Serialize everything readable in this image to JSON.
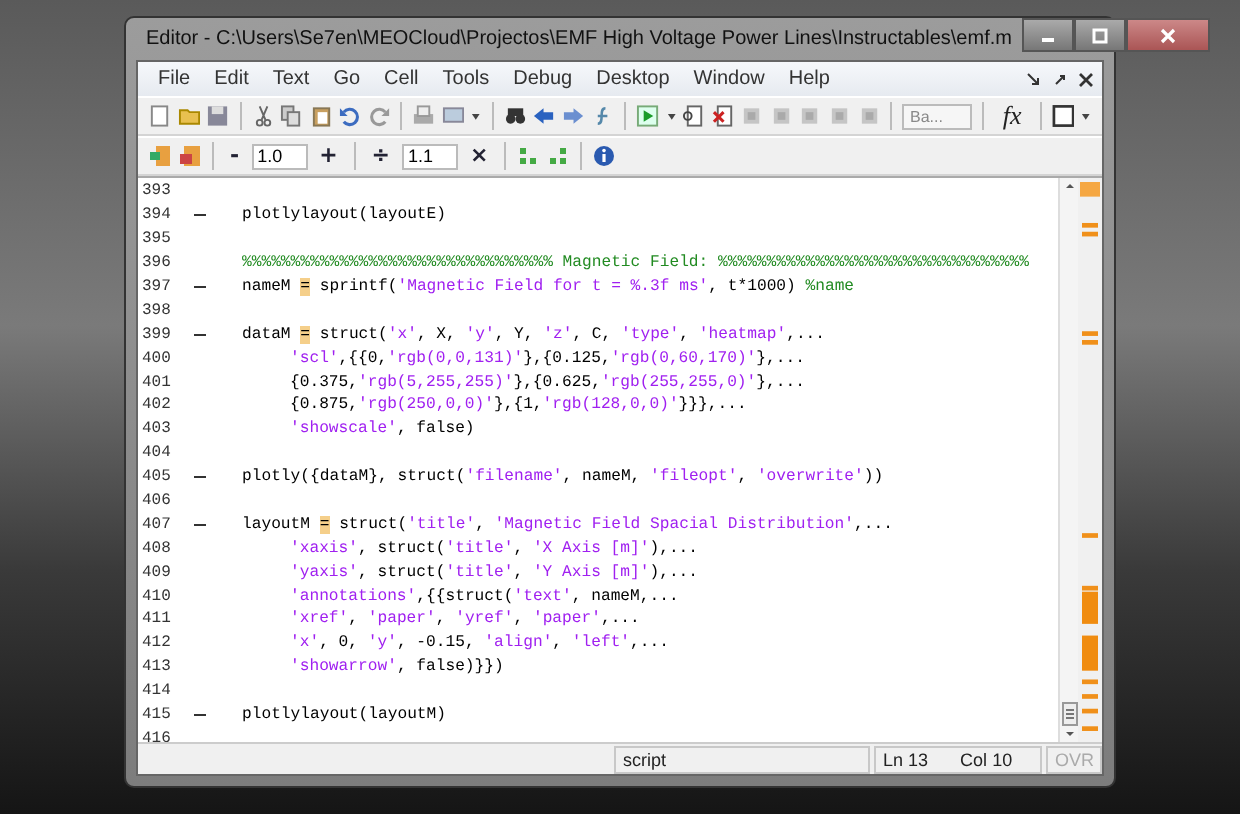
{
  "window": {
    "title": "Editor - C:\\Users\\Se7en\\MEOCloud\\Projectos\\EMF High Voltage Power Lines\\Instructables\\emf.m"
  },
  "menu": [
    "File",
    "Edit",
    "Text",
    "Go",
    "Cell",
    "Tools",
    "Debug",
    "Desktop",
    "Window",
    "Help"
  ],
  "toolbar": {
    "cell_dropdown": "Ba...",
    "fx": "fx"
  },
  "cell_toolbar": {
    "decrement": "-",
    "decrement_value": "1.0",
    "increment": "+",
    "divide": "÷",
    "divide_value": "1.1",
    "multiply": "×"
  },
  "lines": [
    {
      "number": "393",
      "executable": false
    },
    {
      "number": "394",
      "executable": true,
      "segments": [
        {
          "kind": "code",
          "text": "plotlylayout(layoutE)"
        }
      ]
    },
    {
      "number": "395",
      "executable": false
    },
    {
      "number": "396",
      "executable": false,
      "segments": [
        {
          "kind": "comment",
          "text": "%%%%%%%%%%%%%%%%%%%%%%%%%%%%%%%% Magnetic Field: %%%%%%%%%%%%%%%%%%%%%%%%%%%%%%%%"
        }
      ]
    },
    {
      "number": "397",
      "executable": true,
      "segments": [
        {
          "kind": "code",
          "text": "nameM "
        },
        {
          "kind": "marked",
          "text": "="
        },
        {
          "kind": "code",
          "text": " sprintf("
        },
        {
          "kind": "string",
          "text": "'Magnetic Field for t = %.3f ms'"
        },
        {
          "kind": "code",
          "text": ", t*1000) "
        },
        {
          "kind": "comment",
          "text": "%name"
        }
      ]
    },
    {
      "number": "398",
      "executable": false
    },
    {
      "number": "399",
      "executable": true,
      "segments": [
        {
          "kind": "code",
          "text": "dataM "
        },
        {
          "kind": "marked",
          "text": "="
        },
        {
          "kind": "code",
          "text": " struct("
        },
        {
          "kind": "string",
          "text": "'x'"
        },
        {
          "kind": "code",
          "text": ", X, "
        },
        {
          "kind": "string",
          "text": "'y'"
        },
        {
          "kind": "code",
          "text": ", Y, "
        },
        {
          "kind": "string",
          "text": "'z'"
        },
        {
          "kind": "code",
          "text": ", C, "
        },
        {
          "kind": "string",
          "text": "'type'"
        },
        {
          "kind": "code",
          "text": ", "
        },
        {
          "kind": "string",
          "text": "'heatmap'"
        },
        {
          "kind": "code",
          "text": ",..."
        }
      ]
    },
    {
      "number": "400",
      "executable": false,
      "continuation": true,
      "segments": [
        {
          "kind": "string",
          "text": "'scl'"
        },
        {
          "kind": "code",
          "text": ",{{0,"
        },
        {
          "kind": "string",
          "text": "'rgb(0,0,131)'"
        },
        {
          "kind": "code",
          "text": "},{0.125,"
        },
        {
          "kind": "string",
          "text": "'rgb(0,60,170)'"
        },
        {
          "kind": "code",
          "text": "},..."
        }
      ]
    },
    {
      "number": "401",
      "executable": false,
      "continuation": true,
      "segments": [
        {
          "kind": "code",
          "text": "{0.375,"
        },
        {
          "kind": "string",
          "text": "'rgb(5,255,255)'"
        },
        {
          "kind": "code",
          "text": "},{0.625,"
        },
        {
          "kind": "string",
          "text": "'rgb(255,255,0)'"
        },
        {
          "kind": "code",
          "text": "},..."
        }
      ]
    },
    {
      "number": "402",
      "executable": false,
      "continuation": true,
      "segments": [
        {
          "kind": "code",
          "text": "{0.875,"
        },
        {
          "kind": "string",
          "text": "'rgb(250,0,0)'"
        },
        {
          "kind": "code",
          "text": "},{1,"
        },
        {
          "kind": "string",
          "text": "'rgb(128,0,0)'"
        },
        {
          "kind": "code",
          "text": "}}},..."
        }
      ]
    },
    {
      "number": "403",
      "executable": false,
      "continuation": true,
      "segments": [
        {
          "kind": "string",
          "text": "'showscale'"
        },
        {
          "kind": "code",
          "text": ", false)"
        }
      ]
    },
    {
      "number": "404",
      "executable": false
    },
    {
      "number": "405",
      "executable": true,
      "segments": [
        {
          "kind": "code",
          "text": "plotly({dataM}, struct("
        },
        {
          "kind": "string",
          "text": "'filename'"
        },
        {
          "kind": "code",
          "text": ", nameM, "
        },
        {
          "kind": "string",
          "text": "'fileopt'"
        },
        {
          "kind": "code",
          "text": ", "
        },
        {
          "kind": "string",
          "text": "'overwrite'"
        },
        {
          "kind": "code",
          "text": "))"
        }
      ]
    },
    {
      "number": "406",
      "executable": false
    },
    {
      "number": "407",
      "executable": true,
      "segments": [
        {
          "kind": "code",
          "text": "layoutM "
        },
        {
          "kind": "marked",
          "text": "="
        },
        {
          "kind": "code",
          "text": " struct("
        },
        {
          "kind": "string",
          "text": "'title'"
        },
        {
          "kind": "code",
          "text": ", "
        },
        {
          "kind": "string",
          "text": "'Magnetic Field Spacial Distribution'"
        },
        {
          "kind": "code",
          "text": ",..."
        }
      ]
    },
    {
      "number": "408",
      "executable": false,
      "continuation": true,
      "segments": [
        {
          "kind": "string",
          "text": "'xaxis'"
        },
        {
          "kind": "code",
          "text": ", struct("
        },
        {
          "kind": "string",
          "text": "'title'"
        },
        {
          "kind": "code",
          "text": ", "
        },
        {
          "kind": "string",
          "text": "'X Axis [m]'"
        },
        {
          "kind": "code",
          "text": "),..."
        }
      ]
    },
    {
      "number": "409",
      "executable": false,
      "continuation": true,
      "segments": [
        {
          "kind": "string",
          "text": "'yaxis'"
        },
        {
          "kind": "code",
          "text": ", struct("
        },
        {
          "kind": "string",
          "text": "'title'"
        },
        {
          "kind": "code",
          "text": ", "
        },
        {
          "kind": "string",
          "text": "'Y Axis [m]'"
        },
        {
          "kind": "code",
          "text": "),..."
        }
      ]
    },
    {
      "number": "410",
      "executable": false,
      "continuation": true,
      "segments": [
        {
          "kind": "string",
          "text": "'annotations'"
        },
        {
          "kind": "code",
          "text": ",{{struct("
        },
        {
          "kind": "string",
          "text": "'text'"
        },
        {
          "kind": "code",
          "text": ", nameM,..."
        }
      ]
    },
    {
      "number": "411",
      "executable": false,
      "continuation": true,
      "segments": [
        {
          "kind": "string",
          "text": "'xref'"
        },
        {
          "kind": "code",
          "text": ", "
        },
        {
          "kind": "string",
          "text": "'paper'"
        },
        {
          "kind": "code",
          "text": ", "
        },
        {
          "kind": "string",
          "text": "'yref'"
        },
        {
          "kind": "code",
          "text": ", "
        },
        {
          "kind": "string",
          "text": "'paper'"
        },
        {
          "kind": "code",
          "text": ",..."
        }
      ]
    },
    {
      "number": "412",
      "executable": false,
      "continuation": true,
      "segments": [
        {
          "kind": "string",
          "text": "'x'"
        },
        {
          "kind": "code",
          "text": ", 0, "
        },
        {
          "kind": "string",
          "text": "'y'"
        },
        {
          "kind": "code",
          "text": ", -0.15, "
        },
        {
          "kind": "string",
          "text": "'align'"
        },
        {
          "kind": "code",
          "text": ", "
        },
        {
          "kind": "string",
          "text": "'left'"
        },
        {
          "kind": "code",
          "text": ",..."
        }
      ]
    },
    {
      "number": "413",
      "executable": false,
      "continuation": true,
      "segments": [
        {
          "kind": "string",
          "text": "'showarrow'"
        },
        {
          "kind": "code",
          "text": ", false)}})"
        }
      ]
    },
    {
      "number": "414",
      "executable": false
    },
    {
      "number": "415",
      "executable": true,
      "segments": [
        {
          "kind": "code",
          "text": "plotlylayout(layoutM)"
        }
      ]
    },
    {
      "number": "416",
      "executable": false
    }
  ],
  "status_bar": {
    "file_type": "script",
    "line_label": "Ln",
    "line": "13",
    "col_label": "Col",
    "col": "10",
    "overwrite": {
      "text": "OVR",
      "disabled": true
    }
  }
}
